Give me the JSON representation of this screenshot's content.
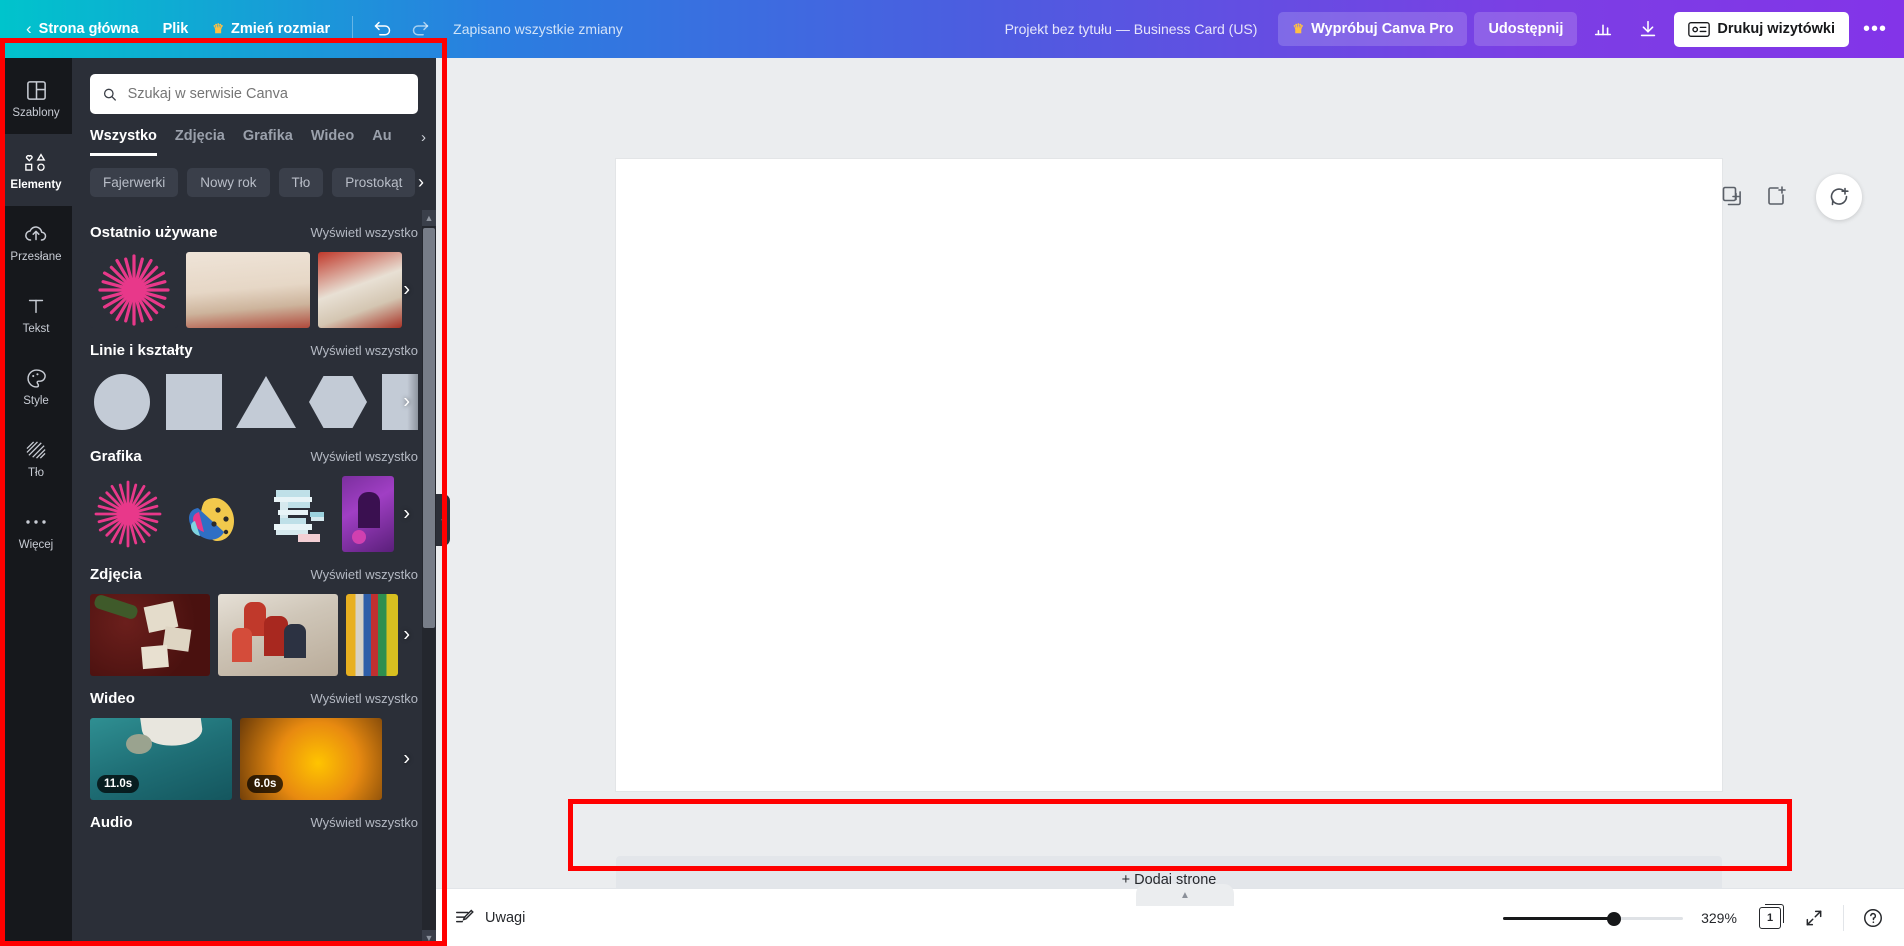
{
  "topbar": {
    "back_label": "Strona główna",
    "file_label": "Plik",
    "resize_label": "Zmień rozmiar",
    "undo_icon": "undo-icon",
    "redo_icon": "redo-icon",
    "saved_status": "Zapisano wszystkie zmiany",
    "doc_title": "Projekt bez tytułu — Business Card (US)",
    "pro_label": "Wypróbuj Canva Pro",
    "share_label": "Udostępnij",
    "stats_icon": "bar-chart-icon",
    "download_icon": "download-icon",
    "print_label": "Drukuj wizytówki",
    "print_icon": "business-card-icon",
    "more_label": "•••"
  },
  "rail": {
    "items": [
      {
        "label": "Szablony",
        "icon": "templates-icon",
        "active": false
      },
      {
        "label": "Elementy",
        "icon": "elements-icon",
        "active": true
      },
      {
        "label": "Przesłane",
        "icon": "upload-cloud-icon",
        "active": false
      },
      {
        "label": "Tekst",
        "icon": "text-icon",
        "active": false
      },
      {
        "label": "Style",
        "icon": "palette-icon",
        "active": false
      },
      {
        "label": "Tło",
        "icon": "background-icon",
        "active": false
      },
      {
        "label": "Więcej",
        "icon": "more-dots-icon",
        "active": false
      }
    ]
  },
  "panel": {
    "search": {
      "placeholder": "Szukaj w serwisie Canva",
      "value": "",
      "icon": "search-icon"
    },
    "tabs": [
      {
        "label": "Wszystko",
        "active": true
      },
      {
        "label": "Zdjęcia",
        "active": false
      },
      {
        "label": "Grafika",
        "active": false
      },
      {
        "label": "Wideo",
        "active": false
      },
      {
        "label": "Au",
        "active": false
      }
    ],
    "tabs_next_icon": "chevron-right-icon",
    "chips": [
      "Fajerwerki",
      "Nowy rok",
      "Tło",
      "Prostokąt"
    ],
    "chips_next_icon": "chevron-right-icon",
    "view_all_label": "Wyświetl wszystko",
    "sections": [
      {
        "title": "Ostatnio używane",
        "view_all": "Wyświetl wszystko"
      },
      {
        "title": "Linie i kształty",
        "view_all": "Wyświetl wszystko"
      },
      {
        "title": "Grafika",
        "view_all": "Wyświetl wszystko"
      },
      {
        "title": "Zdjęcia",
        "view_all": "Wyświetl wszystko"
      },
      {
        "title": "Wideo",
        "view_all": "Wyświetl wszystko"
      },
      {
        "title": "Audio",
        "view_all": "Wyświetl wszystko"
      }
    ],
    "video_durations": [
      "11.0s",
      "6.0s"
    ],
    "collapse_icon": "chevron-left-icon"
  },
  "stage": {
    "duplicate_page_icon": "duplicate-page-icon",
    "add_page_icon": "add-page-icon",
    "comment_icon": "add-comment-icon",
    "add_page_label": "+ Dodaj stronę",
    "scroll_up_icon": "chevron-up-icon"
  },
  "bottombar": {
    "notes_label": "Uwagi",
    "notes_icon": "notes-icon",
    "zoom_value": "329%",
    "page_count": "1",
    "fullscreen_icon": "expand-icon",
    "help_icon": "help-icon",
    "slider_percent": 58
  },
  "colors": {
    "accent_teal": "#00c4cc",
    "accent_purple": "#8334e8",
    "annotation_red": "#ff0000",
    "panel_bg": "#2b2f38",
    "rail_bg": "#16181c",
    "stage_bg": "#ebedef"
  }
}
